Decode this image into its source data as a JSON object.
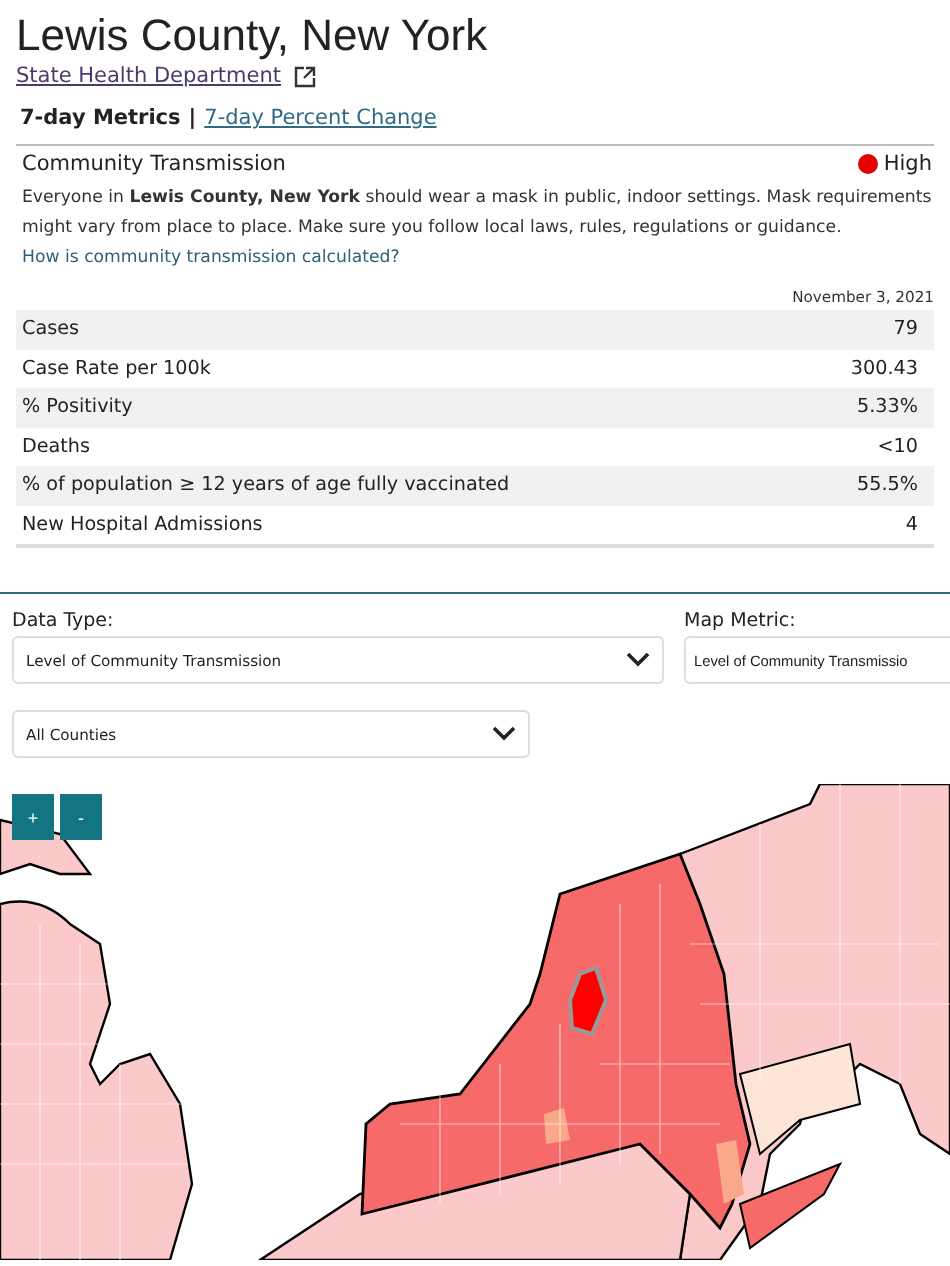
{
  "title": "Lewis County, New York",
  "health_link": "State Health Department",
  "metric_tabs": [
    {
      "label": "7-day Metrics",
      "selected": true
    },
    {
      "label": "7-day Percent Change",
      "selected": false
    }
  ],
  "tab_separator": "|",
  "transmission": {
    "label": "Community Transmission",
    "level": "High",
    "color": "#e60000",
    "message": "Everyone in **Lewis County, New York** should wear a mask in public, indoor settings. Mask requirements might vary from place to place. Make sure you follow local laws, rules, regulations or guidance.",
    "help_link": "How is community transmission calculated?"
  },
  "date": "November 3, 2021",
  "metrics": [
    {
      "label": "Cases",
      "value": "79"
    },
    {
      "label": "Case Rate per 100k",
      "value": "300.43"
    },
    {
      "label": "% Positivity",
      "value": "5.33%"
    },
    {
      "label": "Deaths",
      "value": "<10"
    },
    {
      "label": "% of population ≥ 12 years of age fully vaccinated",
      "value": "55.5%"
    },
    {
      "label": "New Hospital Admissions",
      "value": "4"
    }
  ],
  "filters": {
    "data_type": {
      "label": "Data Type:",
      "value": "Level of Community Transmission"
    },
    "map_metric": {
      "label": "Map Metric:",
      "value": "Level of Community Transmissio"
    },
    "county": {
      "value": "All Counties"
    }
  },
  "zoom_buttons": [
    "+",
    "-"
  ]
}
